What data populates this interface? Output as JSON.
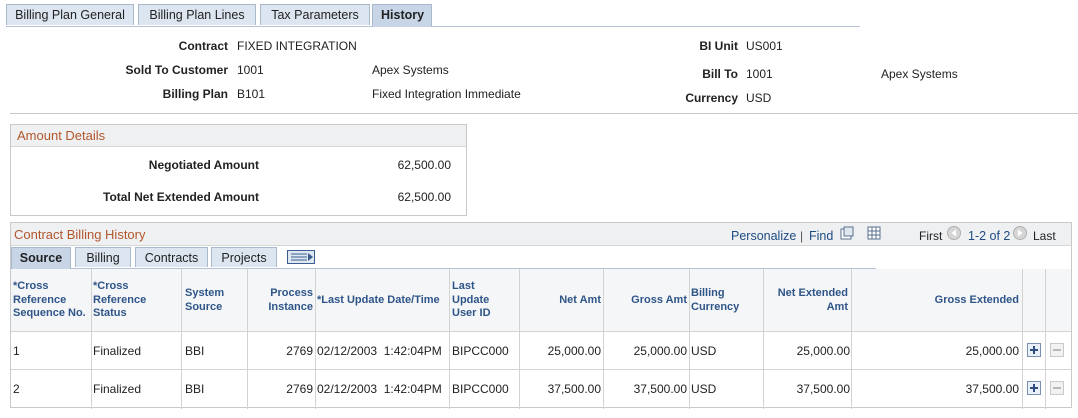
{
  "top_tabs": [
    {
      "label": "Billing Plan General",
      "active": false
    },
    {
      "label": "Billing Plan Lines",
      "active": false
    },
    {
      "label": "Tax Parameters",
      "active": false
    },
    {
      "label": "History",
      "active": true
    }
  ],
  "header": {
    "contract_label": "Contract",
    "contract_value": "FIXED INTEGRATION",
    "sold_to_label": "Sold To Customer",
    "sold_to_value": "1001",
    "sold_to_name": "Apex Systems",
    "billing_plan_label": "Billing Plan",
    "billing_plan_value": "B101",
    "billing_plan_desc": "Fixed Integration Immediate",
    "bi_unit_label": "BI Unit",
    "bi_unit_value": "US001",
    "bill_to_label": "Bill To",
    "bill_to_value": "1001",
    "bill_to_name": "Apex Systems",
    "currency_label": "Currency",
    "currency_value": "USD"
  },
  "amount_details": {
    "title": "Amount Details",
    "negotiated_label": "Negotiated Amount",
    "negotiated_value": "62,500.00",
    "total_net_label": "Total Net Extended Amount",
    "total_net_value": "62,500.00"
  },
  "history": {
    "title": "Contract Billing History",
    "personalize": "Personalize",
    "separator": "|",
    "find": "Find",
    "first": "First",
    "range": "1-2 of 2",
    "last": "Last",
    "subtabs": [
      {
        "label": "Source",
        "active": true
      },
      {
        "label": "Billing",
        "active": false
      },
      {
        "label": "Contracts",
        "active": false
      },
      {
        "label": "Projects",
        "active": false
      }
    ],
    "columns": {
      "xref_seq": "*Cross Reference Sequence No.",
      "xref_status": "*Cross Reference Status",
      "system_source": "System Source",
      "process_instance": "Process Instance",
      "last_update": "*Last Update Date/Time",
      "last_update_user": "Last Update User ID",
      "net_amt": "Net Amt",
      "gross_amt": "Gross Amt",
      "billing_currency": "Billing Currency",
      "net_extended_amt": "Net Extended Amt",
      "gross_extended": "Gross Extended"
    },
    "rows": [
      {
        "seq": "1",
        "status": "Finalized",
        "source": "BBI",
        "process": "2769",
        "updated": "02/12/2003  1:42:04PM",
        "user": "BIPCC000",
        "net": "25,000.00",
        "gross": "25,000.00",
        "currency": "USD",
        "net_ext": "25,000.00",
        "gross_ext": "25,000.00"
      },
      {
        "seq": "2",
        "status": "Finalized",
        "source": "BBI",
        "process": "2769",
        "updated": "02/12/2003  1:42:04PM",
        "user": "BIPCC000",
        "net": "37,500.00",
        "gross": "37,500.00",
        "currency": "USD",
        "net_ext": "37,500.00",
        "gross_ext": "37,500.00"
      }
    ]
  },
  "colors": {
    "title_orange": "#b2572c",
    "link_blue": "#1f4c83",
    "header_blue": "#2f5588",
    "tab_bg": "#dde6f0"
  }
}
